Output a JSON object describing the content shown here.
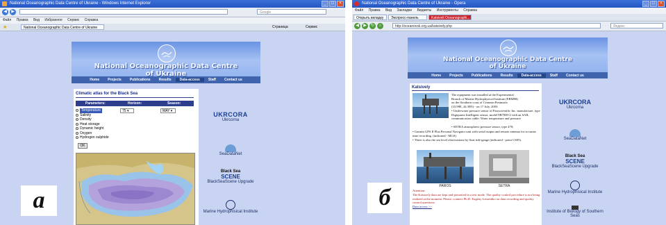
{
  "panel_a": {
    "label": "а",
    "window_title": "National Oceanographic Data Centre of Ukraine - Windows Internet Explorer",
    "menu": [
      "Файл",
      "Правка",
      "Вид",
      "Избранное",
      "Сервис",
      "Справка"
    ],
    "tab": "National Oceanographic Data Centre of Ukraine",
    "search_placeholder": "Google",
    "toolbar_right": [
      "Страница",
      "Сервис"
    ],
    "site_title_line1": "National Oceanographic Data Centre",
    "site_title_line2": "of Ukraine",
    "nav": [
      "Home",
      "Projects",
      "Publications",
      "Results",
      "Data-access",
      "Staff",
      "Contact us"
    ],
    "active_nav": "Data-access",
    "atlas_heading": "Climatic atlas for the Black Sea",
    "table_headers": [
      "Parameters:",
      "Horizon:",
      "Season:"
    ],
    "parameters": [
      "Temperature",
      "Salinity",
      "Density",
      "Heat storage",
      "Dynamic height",
      "Oxygen",
      "Hydrogen sulphide"
    ],
    "selected_parameter": "Temperature",
    "horizon": "75",
    "season": "MAY",
    "ok_label": "OK",
    "partners": [
      "Ukrcorna",
      "SeaDataNet",
      "BlackSeaScene Upgrade",
      "Marine Hydrophisical Institute"
    ]
  },
  "panel_b": {
    "label": "б",
    "window_title": "National Oceanographic Data Centre of Ukraine - Opera",
    "menu": [
      "Файл",
      "Правка",
      "Вид",
      "Закладки",
      "Виджеты",
      "Инструменты",
      "Справка"
    ],
    "tabs": [
      "Открыть вкладку",
      "Экспресс-панель",
      "Katsiveli Oceanographi..."
    ],
    "address": "http://oceanovsk.org.ua/katsively.php",
    "search_placeholder": "Яндекс",
    "site_title_line1": "National Oceanographic Data Centre",
    "site_title_line2": "of Ukraine",
    "nav": [
      "Home",
      "Projects",
      "Publications",
      "Results",
      "Data-access",
      "Staff",
      "Contact us"
    ],
    "active_nav": "Data-access",
    "page_heading": "Katsively",
    "intro_lines": [
      "The equipment was installed at the Experimental",
      "Branch of Marine Hydrophysical Institute (EBMHI)",
      "on the Southern coast of Crimean Peninsula",
      "(33.98E, 44.39N) - on 17 July, 2003:"
    ],
    "bullets": [
      "Underwater pressure sensor of Paroscientific Inc. manufacture, type Digiquartz Intelligent sensor, model 8B7000-2 with an SAIL communication cable; Water temperature and pressure",
      "SETRA atmospheric pressure sensor, type 470;",
      "Garmin GPS II Plus Personal Navigator unit with serial output and remote antenna for accurate time recording. (indicated - MGS)",
      "There is also the sea level observations by float tide-gauge (indicated - point CS05)."
    ],
    "photo_captions": [
      "PAROS",
      "SETRA"
    ],
    "attention_label": "Attention:",
    "attention_text": "The Katsively data are kept and presented in a test mode. The quality control procedure is not being realized at the moment. Please, connect Ph.D. Eugeny Lemeshko on data recording and quality control questions.",
    "data_access": "Data access >>",
    "partners": [
      "Ukrcorna",
      "SeaDataNet",
      "BlackSeaScene Upgrade",
      "Marine Hydrophisical Institute",
      "Institute of Biology of Southern Seas"
    ]
  }
}
